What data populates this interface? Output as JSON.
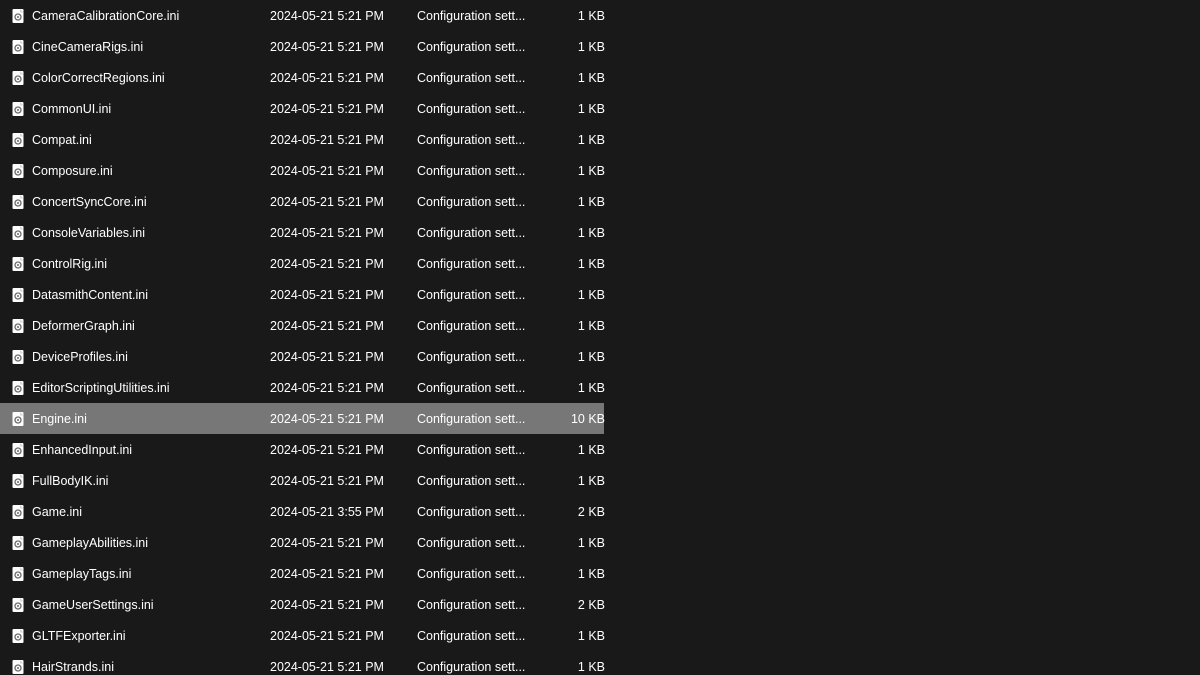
{
  "files": [
    {
      "name": "CameraCalibrationCore.ini",
      "date": "2024-05-21 5:21 PM",
      "type": "Configuration sett...",
      "size": "1 KB",
      "selected": false
    },
    {
      "name": "CineCameraRigs.ini",
      "date": "2024-05-21 5:21 PM",
      "type": "Configuration sett...",
      "size": "1 KB",
      "selected": false
    },
    {
      "name": "ColorCorrectRegions.ini",
      "date": "2024-05-21 5:21 PM",
      "type": "Configuration sett...",
      "size": "1 KB",
      "selected": false
    },
    {
      "name": "CommonUI.ini",
      "date": "2024-05-21 5:21 PM",
      "type": "Configuration sett...",
      "size": "1 KB",
      "selected": false
    },
    {
      "name": "Compat.ini",
      "date": "2024-05-21 5:21 PM",
      "type": "Configuration sett...",
      "size": "1 KB",
      "selected": false
    },
    {
      "name": "Composure.ini",
      "date": "2024-05-21 5:21 PM",
      "type": "Configuration sett...",
      "size": "1 KB",
      "selected": false
    },
    {
      "name": "ConcertSyncCore.ini",
      "date": "2024-05-21 5:21 PM",
      "type": "Configuration sett...",
      "size": "1 KB",
      "selected": false
    },
    {
      "name": "ConsoleVariables.ini",
      "date": "2024-05-21 5:21 PM",
      "type": "Configuration sett...",
      "size": "1 KB",
      "selected": false
    },
    {
      "name": "ControlRig.ini",
      "date": "2024-05-21 5:21 PM",
      "type": "Configuration sett...",
      "size": "1 KB",
      "selected": false
    },
    {
      "name": "DatasmithContent.ini",
      "date": "2024-05-21 5:21 PM",
      "type": "Configuration sett...",
      "size": "1 KB",
      "selected": false
    },
    {
      "name": "DeformerGraph.ini",
      "date": "2024-05-21 5:21 PM",
      "type": "Configuration sett...",
      "size": "1 KB",
      "selected": false
    },
    {
      "name": "DeviceProfiles.ini",
      "date": "2024-05-21 5:21 PM",
      "type": "Configuration sett...",
      "size": "1 KB",
      "selected": false
    },
    {
      "name": "EditorScriptingUtilities.ini",
      "date": "2024-05-21 5:21 PM",
      "type": "Configuration sett...",
      "size": "1 KB",
      "selected": false
    },
    {
      "name": "Engine.ini",
      "date": "2024-05-21 5:21 PM",
      "type": "Configuration sett...",
      "size": "10 KB",
      "selected": true
    },
    {
      "name": "EnhancedInput.ini",
      "date": "2024-05-21 5:21 PM",
      "type": "Configuration sett...",
      "size": "1 KB",
      "selected": false
    },
    {
      "name": "FullBodyIK.ini",
      "date": "2024-05-21 5:21 PM",
      "type": "Configuration sett...",
      "size": "1 KB",
      "selected": false
    },
    {
      "name": "Game.ini",
      "date": "2024-05-21 3:55 PM",
      "type": "Configuration sett...",
      "size": "2 KB",
      "selected": false
    },
    {
      "name": "GameplayAbilities.ini",
      "date": "2024-05-21 5:21 PM",
      "type": "Configuration sett...",
      "size": "1 KB",
      "selected": false
    },
    {
      "name": "GameplayTags.ini",
      "date": "2024-05-21 5:21 PM",
      "type": "Configuration sett...",
      "size": "1 KB",
      "selected": false
    },
    {
      "name": "GameUserSettings.ini",
      "date": "2024-05-21 5:21 PM",
      "type": "Configuration sett...",
      "size": "2 KB",
      "selected": false
    },
    {
      "name": "GLTFExporter.ini",
      "date": "2024-05-21 5:21 PM",
      "type": "Configuration sett...",
      "size": "1 KB",
      "selected": false
    },
    {
      "name": "HairStrands.ini",
      "date": "2024-05-21 5:21 PM",
      "type": "Configuration sett...",
      "size": "1 KB",
      "selected": false
    }
  ]
}
